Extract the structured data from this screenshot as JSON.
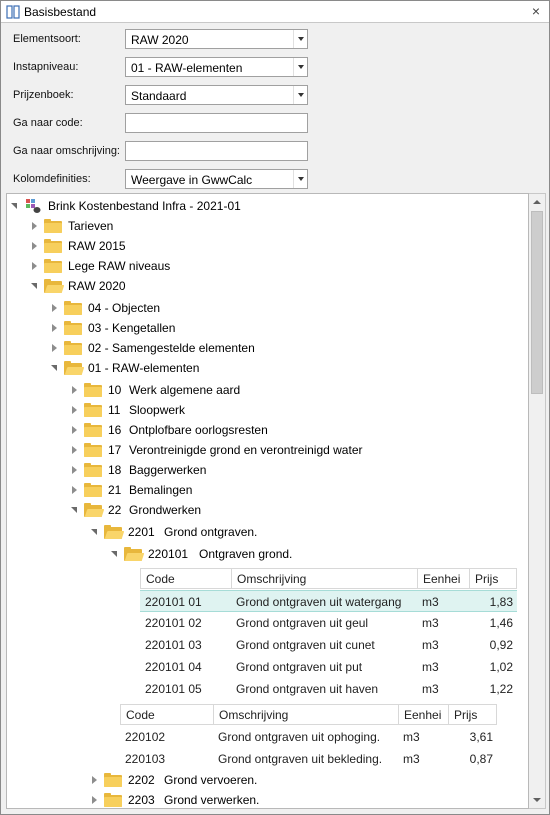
{
  "window": {
    "title": "Basisbestand",
    "close_icon": "close-icon"
  },
  "form": {
    "elementsoort": {
      "label": "Elementsoort:",
      "value": "RAW 2020"
    },
    "instapniveau": {
      "label": "Instapniveau:",
      "value": "01 - RAW-elementen"
    },
    "prijzenboek": {
      "label": "Prijzenboek:",
      "value": "Standaard"
    },
    "ga_naar_code": {
      "label": "Ga naar code:",
      "value": ""
    },
    "ga_naar_omschrijving": {
      "label": "Ga naar omschrijving:",
      "value": ""
    },
    "kolomdefinities": {
      "label": "Kolomdefinities:",
      "value": "Weergave in GwwCalc"
    }
  },
  "tree": {
    "root": "Brink Kostenbestand Infra - 2021-01",
    "level1": [
      "Tarieven",
      "RAW 2015",
      "Lege RAW niveaus",
      "RAW 2020"
    ],
    "raw2020_children": [
      "04 - Objecten",
      "03 - Kengetallen",
      "02 - Samengestelde elementen",
      "01 - RAW-elementen"
    ],
    "raw_elementen": [
      {
        "code": "10",
        "name": "Werk algemene aard"
      },
      {
        "code": "11",
        "name": "Sloopwerk"
      },
      {
        "code": "16",
        "name": "Ontplofbare oorlogsresten"
      },
      {
        "code": "17",
        "name": "Verontreinigde grond en verontreinigd water"
      },
      {
        "code": "18",
        "name": "Baggerwerken"
      },
      {
        "code": "21",
        "name": "Bemalingen"
      },
      {
        "code": "22",
        "name": "Grondwerken"
      }
    ],
    "grondwerken_children": [
      {
        "code": "2201",
        "name": "Grond ontgraven."
      },
      {
        "code": "2202",
        "name": "Grond vervoeren."
      },
      {
        "code": "2203",
        "name": "Grond verwerken."
      }
    ],
    "sub2201": {
      "code": "220101",
      "name": "Ontgraven grond."
    }
  },
  "table_inner": {
    "headers": [
      "Code",
      "Omschrijving",
      "Eenhei",
      "Prijs"
    ],
    "rows": [
      {
        "code": "220101 01",
        "desc": "Grond ontgraven uit watergang",
        "unit": "m3",
        "price": "1,83"
      },
      {
        "code": "220101 02",
        "desc": "Grond ontgraven uit geul",
        "unit": "m3",
        "price": "1,46"
      },
      {
        "code": "220101 03",
        "desc": "Grond ontgraven uit cunet",
        "unit": "m3",
        "price": "0,92"
      },
      {
        "code": "220101 04",
        "desc": "Grond ontgraven uit put",
        "unit": "m3",
        "price": "1,02"
      },
      {
        "code": "220101 05",
        "desc": "Grond ontgraven uit haven",
        "unit": "m3",
        "price": "1,22"
      }
    ]
  },
  "table_outer": {
    "headers": [
      "Code",
      "Omschrijving",
      "Eenhei",
      "Prijs"
    ],
    "rows": [
      {
        "code": "220102",
        "desc": "Grond ontgraven uit ophoging.",
        "unit": "m3",
        "price": "3,61"
      },
      {
        "code": "220103",
        "desc": "Grond ontgraven uit bekleding.",
        "unit": "m3",
        "price": "0,87"
      }
    ]
  },
  "colors": {
    "folder": "#f7cf5c",
    "selection": "#dff3f1",
    "border": "#a0a0a0"
  }
}
